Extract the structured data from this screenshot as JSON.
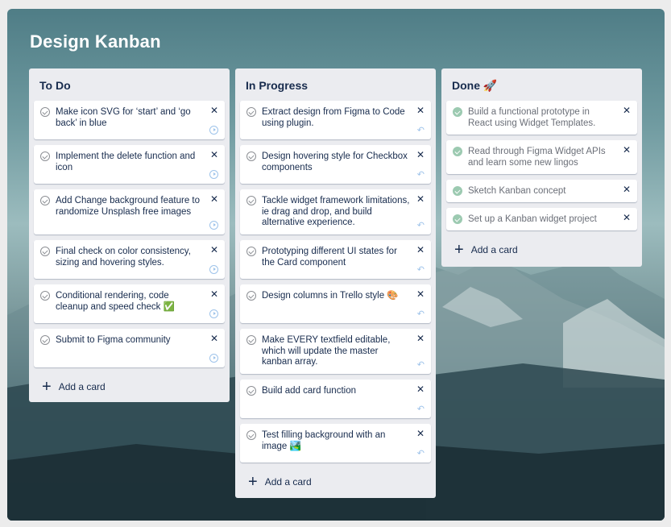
{
  "board": {
    "title": "Design Kanban"
  },
  "add_label": "Add a card",
  "columns": [
    {
      "title": "To Do",
      "cards": [
        {
          "text": "Make icon SVG for ‘start’ and ‘go back’ in blue"
        },
        {
          "text": "Implement the delete function and icon"
        },
        {
          "text": "Add Change background feature to randomize Unsplash free images"
        },
        {
          "text": "Final check on color consistency, sizing and hovering styles."
        },
        {
          "text": "Conditional rendering, code cleanup and speed check ✅"
        },
        {
          "text": "Submit to Figma community"
        }
      ]
    },
    {
      "title": "In Progress",
      "cards": [
        {
          "text": "Extract design from Figma to Code using plugin."
        },
        {
          "text": "Design hovering style for Checkbox components"
        },
        {
          "text": "Tackle widget framework limitations, ie drag and drop, and build alternative experience."
        },
        {
          "text": " Prototyping different UI states for the Card component"
        },
        {
          "text": "Design columns in Trello style 🎨"
        },
        {
          "text": "Make EVERY textfield editable, which will update the master kanban array."
        },
        {
          "text": "Build add card function"
        },
        {
          "text": "Test filling background with an image 🏞️"
        }
      ]
    },
    {
      "title": "Done 🚀",
      "cards": [
        {
          "text": "Build a functional prototype in React using Widget Templates."
        },
        {
          "text": "Read through Figma Widget APIs and learn some new lingos"
        },
        {
          "text": "Sketch Kanban concept"
        },
        {
          "text": "Set up a Kanban widget project"
        }
      ]
    }
  ],
  "colors": {
    "column_bg": "#ebecf0",
    "card_bg": "#ffffff",
    "text": "#172b4d",
    "done_check": "#9ccab1",
    "action_icon": "#9ec3ea"
  },
  "icons": {
    "card_check": "check-circle-icon",
    "card_delete": "close-icon",
    "todo_action": "play-circle-icon",
    "progress_action": "undo-icon",
    "add": "plus-icon"
  }
}
